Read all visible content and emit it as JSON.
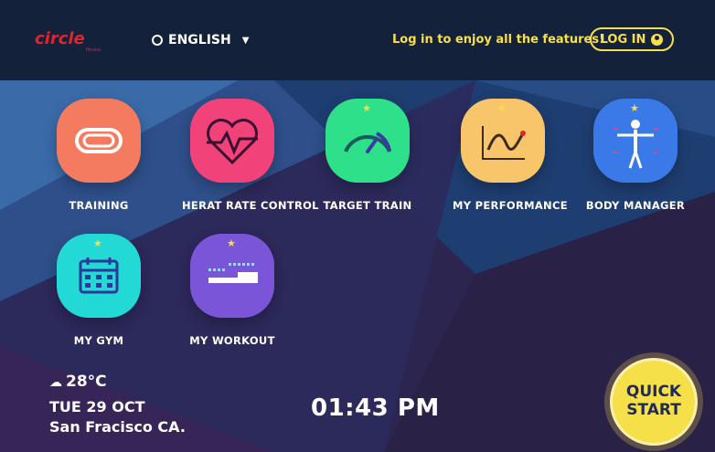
{
  "header": {
    "brand": "circle",
    "brand_sub": "fitness",
    "language": "ENGLISH",
    "promo_text": "Log in to enjoy all the features!",
    "login_label": "LOG IN"
  },
  "tiles": [
    {
      "label": "TRAINING",
      "color": "#f47b5f",
      "icon": "track-icon"
    },
    {
      "label": "HERAT RATE CONTROL",
      "color": "#f2427a",
      "icon": "heart-rate-icon"
    },
    {
      "label": "TARGET TRAIN",
      "color": "#2ee08a",
      "icon": "gauge-icon"
    },
    {
      "label": "MY PERFORMANCE",
      "color": "#f9c56a",
      "icon": "performance-chart-icon"
    },
    {
      "label": "BODY MANAGER",
      "color": "#3a7ae8",
      "icon": "body-icon"
    },
    {
      "label": "MY GYM",
      "color": "#22d9d6",
      "icon": "calendar-icon"
    },
    {
      "label": "MY WORKOUT",
      "color": "#7b55d8",
      "icon": "workout-steps-icon"
    }
  ],
  "status": {
    "weather": "28°C",
    "date": "TUE 29 OCT",
    "city": "San Fracisco CA.",
    "time": "01:43 PM"
  },
  "quick_start": {
    "line1": "QUICK",
    "line2": "START"
  },
  "colors": {
    "accent": "#f6e04a",
    "topbar": "#14213a"
  }
}
